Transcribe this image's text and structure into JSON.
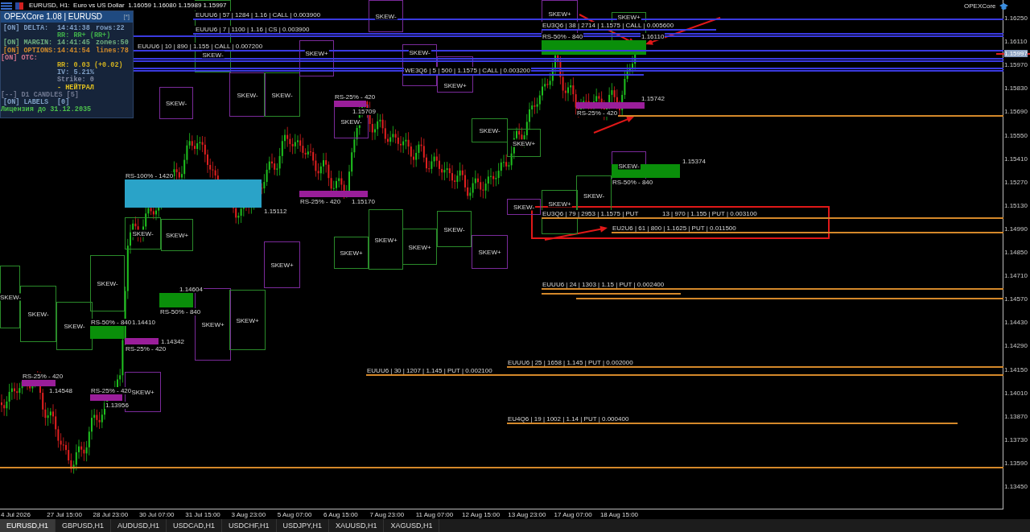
{
  "window": {
    "title": "EURUSD, H1:  Euro vs US Dollar  1.16059 1.16080 1.15989 1.15997"
  },
  "panel": {
    "title": "OPEXCore 1.08  |  EURUSD",
    "button": "[*]",
    "rows": [
      {
        "kind": "main",
        "color": "#7f9fc5",
        "texts": [
          "[ON] DELTA:",
          "14:41:38",
          "rows:22"
        ]
      },
      {
        "kind": "sub",
        "color": "#3fae4a",
        "texts": [
          "RR: RR+ (RR+)"
        ]
      },
      {
        "kind": "main",
        "color": "#6fae80",
        "texts": [
          "[ON] MARGIN:",
          "14:41:45",
          "zones:50"
        ]
      },
      {
        "kind": "main",
        "color": "#d08a2a",
        "texts": [
          "[ON] OPTIONS:",
          "14:41:54",
          "lines:78"
        ]
      },
      {
        "kind": "main",
        "color": "#d0708a",
        "texts": [
          "[ON] OTC:"
        ]
      },
      {
        "kind": "sub",
        "color": "#d0b020",
        "texts": [
          "RR: 0.03 (+0.02)"
        ]
      },
      {
        "kind": "sub",
        "color": "#7f9fc5",
        "texts": [
          "IV: 5.21%"
        ]
      },
      {
        "kind": "sub",
        "color": "#8088a0",
        "texts": [
          "Strike: 0"
        ]
      },
      {
        "kind": "sub",
        "color": "#e0c020",
        "texts": [
          "- НЕЙТРАЛ"
        ]
      },
      {
        "kind": "main",
        "color": "#707890",
        "texts": [
          "[--] D1 CANDLES [5]"
        ]
      },
      {
        "kind": "main",
        "color": "#7f9fc5",
        "texts": [
          "[ON] LABELS",
          "[0]"
        ]
      },
      {
        "kind": "main",
        "color": "#4cc04c",
        "texts": [
          "Лицензия до 31.12.2035"
        ]
      }
    ]
  },
  "brand": "OPEXCore",
  "skew_boxes": [
    {
      "label": "SKEW-",
      "color": "#2a8a2a"
    },
    {
      "label": "SKEW-",
      "color": "#2a8a2a"
    },
    {
      "label": "SKEW-",
      "color": "#2a8a2a"
    },
    {
      "label": "SKEW-",
      "color": "#2a8a2a"
    },
    {
      "label": "SKEW-",
      "color": "#2a8a2a"
    },
    {
      "label": "SKEW+",
      "color": "#2a8a2a"
    },
    {
      "label": "SKEW+",
      "color": "#7a2a9a"
    },
    {
      "label": "SKEW-",
      "color": "#7a2a9a"
    },
    {
      "label": "SKEW+",
      "color": "#7a2a9a"
    },
    {
      "label": "SKEW-",
      "color": "#7a2a9a"
    },
    {
      "label": "SKEW+",
      "color": "#2a8a2a"
    },
    {
      "label": "SKEW-",
      "color": "#2a8a2a"
    },
    {
      "label": "SKEW+",
      "color": "#7a2a9a"
    },
    {
      "label": "SKEW-",
      "color": "#2a8a2a"
    },
    {
      "label": "SKEW+",
      "color": "#7a2a9a"
    },
    {
      "label": "SKEW+",
      "color": "#2a8a2a"
    },
    {
      "label": "SKEW+",
      "color": "#2a8a2a"
    },
    {
      "label": "SKEW+",
      "color": "#2a8a2a"
    },
    {
      "label": "SKEW-",
      "color": "#2a8a2a"
    },
    {
      "label": "SKEW+",
      "color": "#7a2a9a"
    },
    {
      "label": "SKEW-",
      "color": "#7a2a9a"
    },
    {
      "label": "SKEW-",
      "color": "#7a2a9a"
    },
    {
      "label": "SKEW+",
      "color": "#7a2a9a"
    },
    {
      "label": "SKEW-",
      "color": "#2a8a2a"
    },
    {
      "label": "SKEW+",
      "color": "#2a8a2a"
    },
    {
      "label": "SKEW-",
      "color": "#7a2a9a"
    },
    {
      "label": "SKEW+",
      "color": "#2a8a2a"
    },
    {
      "label": "SKEW-",
      "color": "#2a8a2a"
    },
    {
      "label": "SKEW+",
      "color": "#7a2a9a"
    },
    {
      "label": "SKEW+",
      "color": "#2a8a2a"
    },
    {
      "label": "SKEW-",
      "color": "#7a2a9a"
    },
    {
      "label": "SKEW-",
      "color": "#7a2a9a"
    }
  ],
  "zones": [
    {
      "kind": "half",
      "label": "RS-50% - 840",
      "price": "1.16110"
    },
    {
      "kind": "quarter",
      "label": "RS-25% - 420",
      "price": "1.15709"
    },
    {
      "kind": "quarter",
      "label": "RS-25% - 420",
      "price": "1.15742"
    },
    {
      "kind": "half",
      "label": "RS-50% - 840",
      "price": "1.15374"
    },
    {
      "kind": "full",
      "label": "RS-100% - 1420",
      "price": "1.15112"
    },
    {
      "kind": "quarter",
      "label": "RS-25% - 420",
      "price": "1.15170"
    },
    {
      "kind": "half",
      "label": "RS-50% - 840",
      "price": "1.14604"
    },
    {
      "kind": "half",
      "label": "RS-50% - 840",
      "price": "1.14410"
    },
    {
      "kind": "quarter",
      "label": "RS-25% - 420",
      "price": "1.14342"
    },
    {
      "kind": "quarter",
      "label": "RS-25% - 420",
      "price": "1.14548"
    },
    {
      "kind": "quarter",
      "label": "RS-25% - 420",
      "price": "1.13956"
    }
  ],
  "option_lines": [
    {
      "kind": "call",
      "label": "EUUU6 | 57 | 1284 | 1.16 | CALL | 0.003900"
    },
    {
      "kind": "call",
      "label": "EUUU6 | 7 | 1100 | 1.16 | CS | 0.003900"
    },
    {
      "kind": "call",
      "label": "EU3Q6 | 38 | 2714 | 1.1575 | CALL | 0.005600"
    },
    {
      "kind": "call",
      "label": "EUUU6 | 10 | 890 | 1.155 | CALL | 0.007200"
    },
    {
      "kind": "call",
      "label": "WE3Q6 | 5 | 500 | 1.1575 | CALL | 0.003200"
    },
    {
      "kind": "put",
      "label": "EU3Q6 | 79 | 2953 | 1.1575 | PUT"
    },
    {
      "kind": "put",
      "label": "13 | 970 | 1.155 | PUT | 0.003100"
    },
    {
      "kind": "put",
      "label": "EU2U6 | 61 | 800 | 1.1625 | PUT | 0.011500"
    },
    {
      "kind": "put",
      "label": "EUUU6 | 24 | 1303 | 1.15 | PUT | 0.002400"
    },
    {
      "kind": "put",
      "label": "EUUU6 | 25 | 1658 | 1.145 | PUT | 0.002000"
    },
    {
      "kind": "put",
      "label": "EUUU6 | 30 | 1207 | 1.145 | PUT | 0.002100"
    },
    {
      "kind": "put",
      "label": "EU4Q6 | 19 | 1002 | 1.14 | PUT | 0.000400"
    }
  ],
  "price_axis": [
    "1.16250",
    "1.16110",
    "1.15970",
    "1.15830",
    "1.15690",
    "1.15550",
    "1.15410",
    "1.15270",
    "1.15130",
    "1.14990",
    "1.14850",
    "1.14710",
    "1.14570",
    "1.14430",
    "1.14290",
    "1.14150",
    "1.14010",
    "1.13870",
    "1.13730",
    "1.13590",
    "1.13450"
  ],
  "current_price": "1.15997",
  "time_axis": [
    "4 Jul 2026",
    "27 Jul 15:00",
    "28 Jul 23:00",
    "30 Jul 07:00",
    "31 Jul 15:00",
    "3 Aug 23:00",
    "5 Aug 07:00",
    "6 Aug 15:00",
    "7 Aug 23:00",
    "11 Aug 07:00",
    "12 Aug 15:00",
    "13 Aug 23:00",
    "17 Aug 07:00",
    "18 Aug 15:00"
  ],
  "tabs": [
    {
      "label": "EURUSD,H1",
      "selected": true
    },
    {
      "label": "GBPUSD,H1",
      "selected": false
    },
    {
      "label": "AUDUSD,H1",
      "selected": false
    },
    {
      "label": "USDCAD,H1",
      "selected": false
    },
    {
      "label": "USDCHF,H1",
      "selected": false
    },
    {
      "label": "USDJPY,H1",
      "selected": false
    },
    {
      "label": "XAUUSD,H1",
      "selected": false
    },
    {
      "label": "XAGUSD,H1",
      "selected": false
    }
  ]
}
